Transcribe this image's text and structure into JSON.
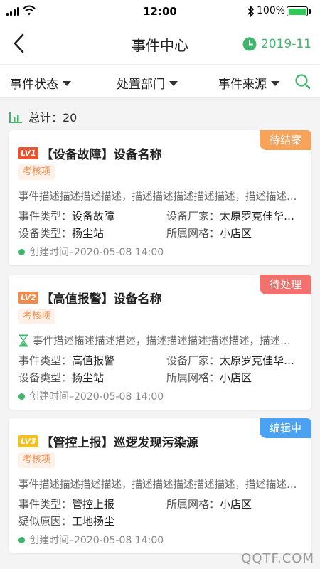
{
  "status_bar": {
    "time": "12:00",
    "battery_pct": "100%"
  },
  "nav": {
    "title": "事件中心",
    "date": "2019-11"
  },
  "filters": [
    {
      "label": "事件状态"
    },
    {
      "label": "处置部门"
    },
    {
      "label": "事件来源"
    }
  ],
  "summary": {
    "text": "总计：20"
  },
  "colors": {
    "accent": "#3fb66b",
    "pending_close": "#f8a35a",
    "pending_handle": "#f2706e",
    "editing": "#4aa3f2"
  },
  "cards": [
    {
      "level": "LV1",
      "title": "【设备故障】设备名称",
      "status": "待结案",
      "tag": "考核项",
      "desc": "事件描述描述描述描述，描述描述描述描述描述，描述描述描述描述描述",
      "f1_key": "事件类型：",
      "f1_val": "设备故障",
      "f2_key": "设备厂家：",
      "f2_val": "太原罗克佳华…",
      "f3_key": "设备类型：",
      "f3_val": "扬尘站",
      "f4_key": "所属网格：",
      "f4_val": "小店区",
      "created": "创建时间–2020-05-08   14:00"
    },
    {
      "level": "LV2",
      "title": "【高值报警】设备名称",
      "status": "待处理",
      "tag": "考核项",
      "desc": "事件描述描述描述描述，描述描述描述描述描述，描述描述描述描述描述",
      "f1_key": "事件类型：",
      "f1_val": "高值报警",
      "f2_key": "设备厂家：",
      "f2_val": "太原罗克佳华…",
      "f3_key": "设备类型：",
      "f3_val": "扬尘站",
      "f4_key": "所属网格：",
      "f4_val": "小店区",
      "created": "创建时间–2020-05-08   14:00"
    },
    {
      "level": "LV3",
      "title": "【管控上报】巡逻发现污染源",
      "status": "编辑中",
      "tag": "考核项",
      "desc": "事件描述描述描述描述，描述描述描述描述描述，描述描述描述描述描述",
      "f1_key": "事件类型：",
      "f1_val": "管控上报",
      "f2_key": "所属网格：",
      "f2_val": "小店区",
      "f3_key": "疑似原因：",
      "f3_val": "工地扬尘",
      "created": "创建时间–2020-05-08   14:00"
    }
  ],
  "watermark": "QQTF.COM"
}
